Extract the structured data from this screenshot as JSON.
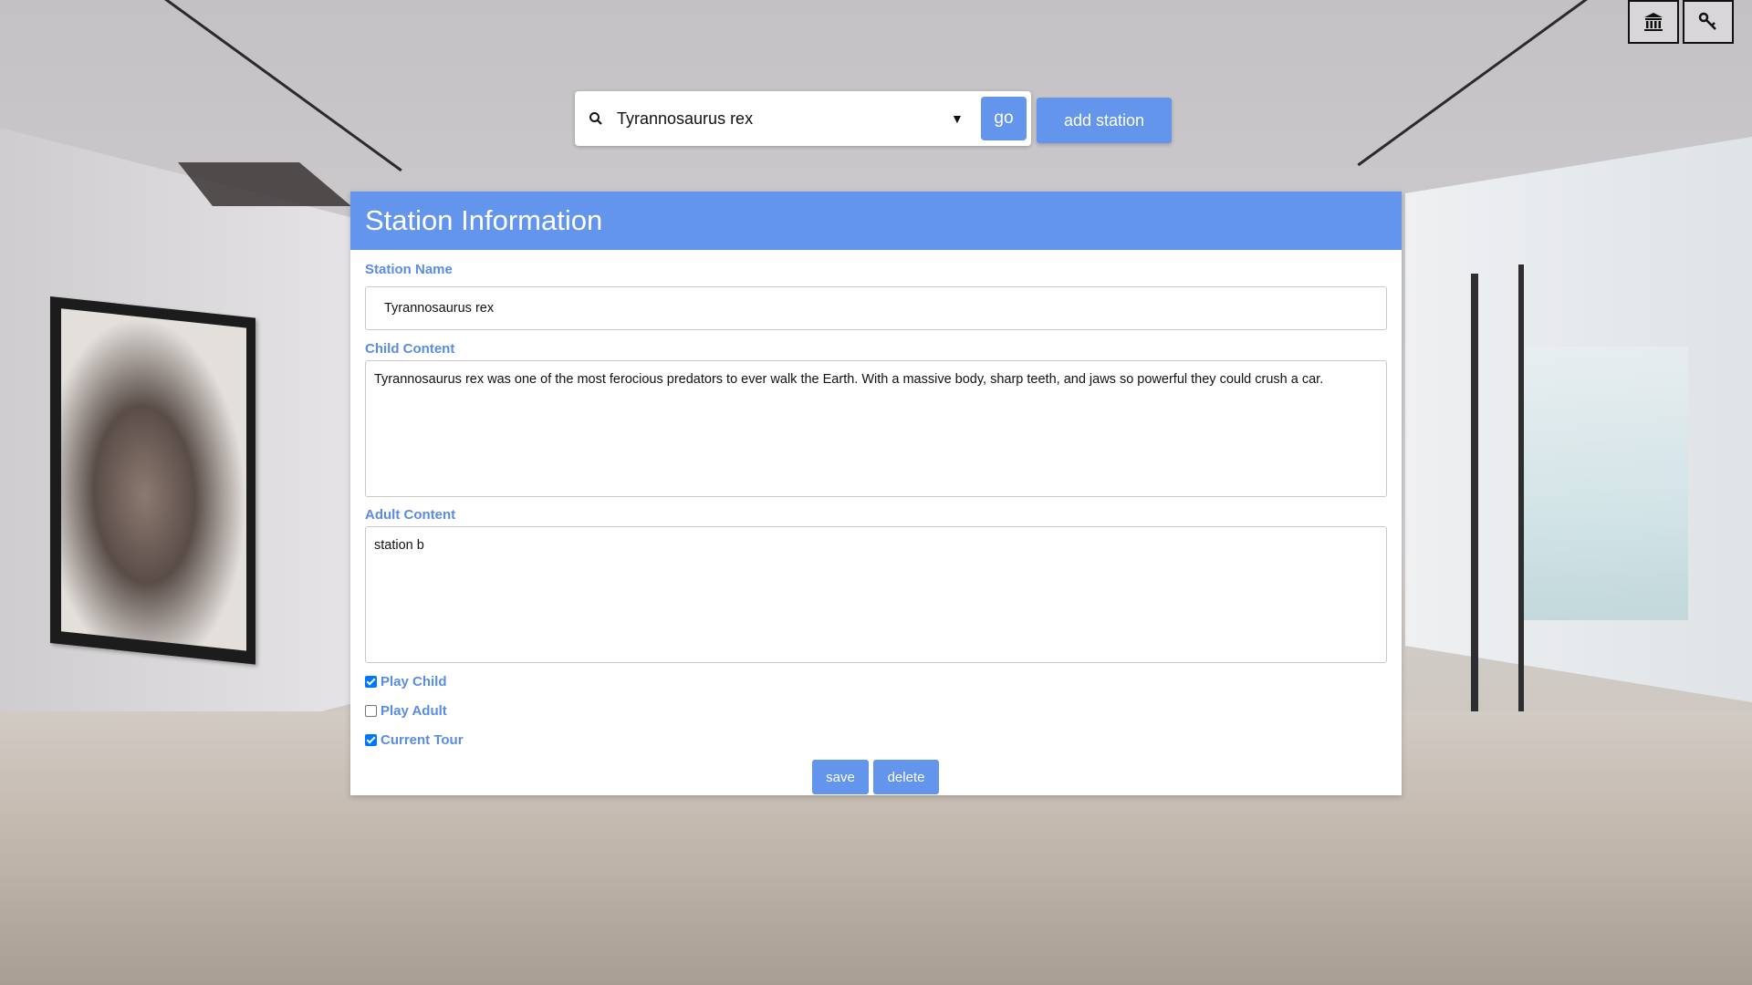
{
  "toolbar": {
    "museum_icon": "museum-icon",
    "key_icon": "key-icon"
  },
  "search": {
    "selected_value": "Tyrannosaurus rex",
    "go_label": "go",
    "add_station_label": "add station"
  },
  "panel": {
    "title": "Station Information",
    "station_name_label": "Station Name",
    "station_name_value": "Tyrannosaurus rex",
    "child_content_label": "Child Content",
    "child_content_value": "Tyrannosaurus rex was one of the most ferocious predators to ever walk the Earth. With a massive body, sharp teeth, and jaws so powerful they could crush a car.",
    "adult_content_label": "Adult Content",
    "adult_content_value": "station b",
    "checkboxes": [
      {
        "label": "Play Child",
        "checked": true
      },
      {
        "label": "Play Adult",
        "checked": false
      },
      {
        "label": "Current Tour",
        "checked": true
      }
    ],
    "save_label": "save",
    "delete_label": "delete"
  },
  "colors": {
    "accent": "#6495ed",
    "label": "#5a8ce6"
  }
}
